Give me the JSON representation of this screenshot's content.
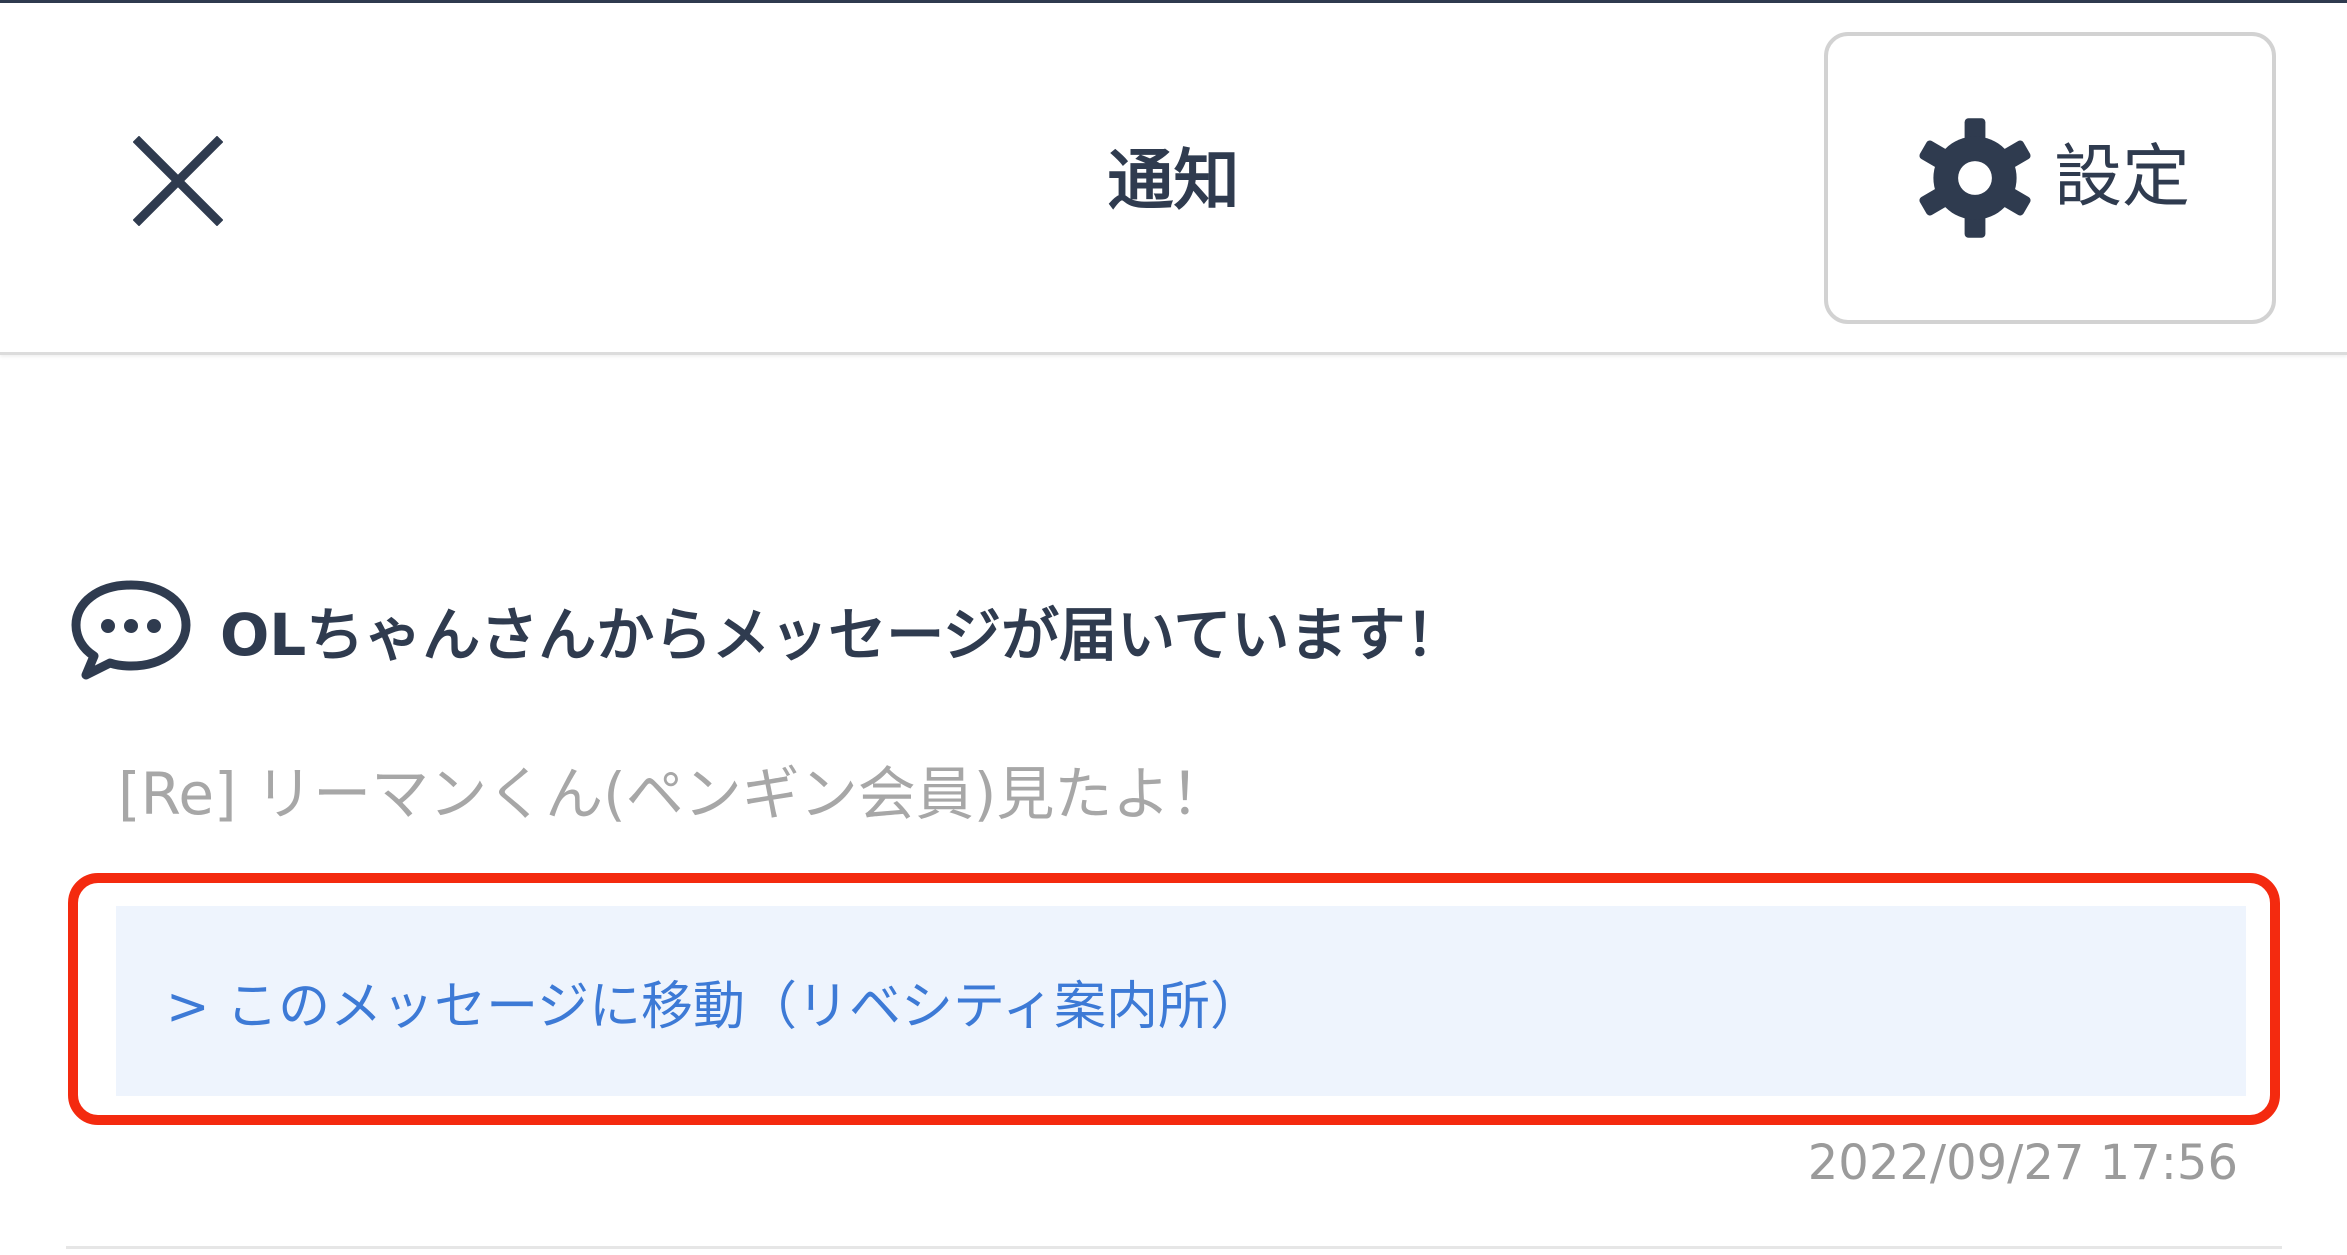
{
  "header": {
    "title": "通知",
    "close_icon": "close-icon",
    "settings_label": "設定",
    "settings_icon": "gear-icon"
  },
  "notification": {
    "icon": "chat-bubble-icon",
    "title": "OLちゃんさんからメッセージが届いています！",
    "body": "[Re] リーマンくん(ペンギン会員)見たよ！",
    "link_text": "> このメッセージに移動（リベシティ案内所）",
    "timestamp": "2022/09/27 17:56"
  },
  "colors": {
    "text_primary": "#2f3b4f",
    "text_muted": "#a7a7a7",
    "link": "#3d7ad6",
    "link_background": "#eef4fd",
    "highlight_border": "#f42a0f"
  }
}
